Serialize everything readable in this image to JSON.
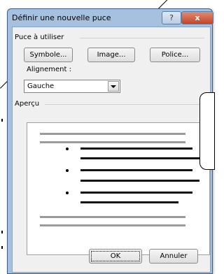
{
  "dialog": {
    "title": "Définir une nouvelle puce",
    "help_label": "?",
    "close_label": "x"
  },
  "bullet_section": {
    "label": "Puce à utiliser",
    "buttons": [
      "Symbole...",
      "Image...",
      "Police..."
    ]
  },
  "alignment": {
    "label": "Alignement :",
    "value": "Gauche"
  },
  "preview": {
    "label": "Aperçu"
  },
  "footer": {
    "ok_label": "OK",
    "cancel_label": "Annuler"
  }
}
